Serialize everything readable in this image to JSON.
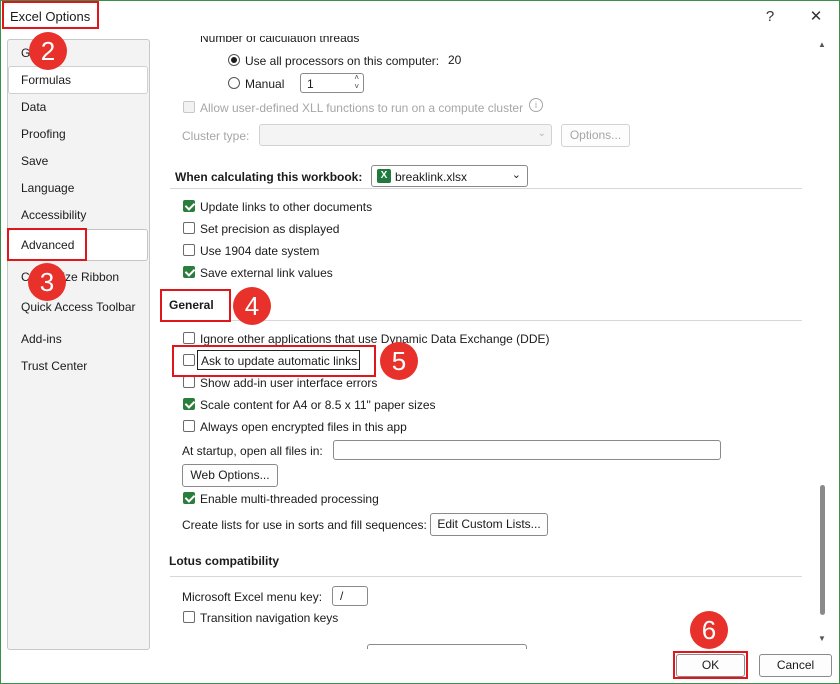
{
  "window": {
    "title": "Excel Options",
    "help_label": "?",
    "close_label": "✕"
  },
  "sidebar": {
    "items": [
      {
        "label": "General"
      },
      {
        "label": "Formulas"
      },
      {
        "label": "Data"
      },
      {
        "label": "Proofing"
      },
      {
        "label": "Save"
      },
      {
        "label": "Language"
      },
      {
        "label": "Accessibility"
      },
      {
        "label": "Advanced"
      },
      {
        "label": "Customize Ribbon"
      },
      {
        "label": "Quick Access Toolbar"
      },
      {
        "label": "Add-ins"
      },
      {
        "label": "Trust Center"
      }
    ],
    "selected": "Advanced"
  },
  "formulas": {
    "threads_heading": "Number of calculation threads",
    "use_all_label": "Use all processors on this computer:",
    "use_all_value": "20",
    "manual_label": "Manual",
    "manual_value": "1",
    "xll_label": "Allow user-defined XLL functions to run on a compute cluster",
    "cluster_type_label": "Cluster type:",
    "cluster_options_button": "Options..."
  },
  "workbook": {
    "heading": "When calculating this workbook:",
    "selected_workbook": "breaklink.xlsx",
    "options": [
      {
        "label": "Update links to other documents",
        "checked": true
      },
      {
        "label": "Set precision as displayed",
        "checked": false
      },
      {
        "label": "Use 1904 date system",
        "checked": false
      },
      {
        "label": "Save external link values",
        "checked": true
      }
    ]
  },
  "general": {
    "heading": "General",
    "options": [
      {
        "label": "Ignore other applications that use Dynamic Data Exchange (DDE)",
        "checked": false
      },
      {
        "label": "Ask to update automatic links",
        "checked": false
      },
      {
        "label": "Show add-in user interface errors",
        "checked": false
      },
      {
        "label": "Scale content for A4 or 8.5 x 11\" paper sizes",
        "checked": true
      },
      {
        "label": "Always open encrypted files in this app",
        "checked": false
      }
    ],
    "startup_label": "At startup, open all files in:",
    "startup_value": "",
    "web_options_button": "Web Options...",
    "multithread_label": "Enable multi-threaded processing",
    "multithread_checked": true,
    "custom_lists_label": "Create lists for use in sorts and fill sequences:",
    "custom_lists_button": "Edit Custom Lists..."
  },
  "lotus": {
    "heading": "Lotus compatibility",
    "menu_key_label": "Microsoft Excel menu key:",
    "menu_key_value": "/",
    "transition_label": "Transition navigation keys",
    "transition_checked": false
  },
  "footer": {
    "ok_label": "OK",
    "cancel_label": "Cancel"
  },
  "annotations": {
    "badge_2": "2",
    "badge_3": "3",
    "badge_4": "4",
    "badge_5": "5",
    "badge_6": "6"
  },
  "colors": {
    "accent_green": "#2b7d3b",
    "annotation_red": "#e0161b",
    "badge_red": "#e8312b"
  }
}
